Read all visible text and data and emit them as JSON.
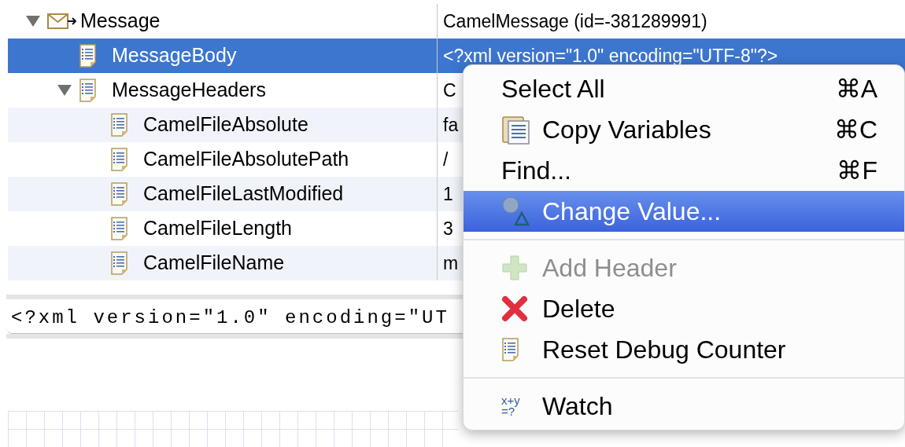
{
  "tree": [
    {
      "name": "Message",
      "kind": "message",
      "value": "CamelMessage (id=-381289991)",
      "expanded": true,
      "selected": false,
      "children": [
        {
          "name": "MessageBody",
          "kind": "variable",
          "value": "<?xml version=\"1.0\" encoding=\"UTF-8\"?>",
          "selected": true
        },
        {
          "name": "MessageHeaders",
          "kind": "variable",
          "value": "C",
          "expanded": true,
          "selected": false,
          "children": [
            {
              "name": "CamelFileAbsolute",
              "kind": "variable",
              "value": "fa",
              "selected": false
            },
            {
              "name": "CamelFileAbsolutePath",
              "kind": "variable",
              "value": "/",
              "selected": false
            },
            {
              "name": "CamelFileLastModified",
              "kind": "variable",
              "value": "1",
              "selected": false
            },
            {
              "name": "CamelFileLength",
              "kind": "variable",
              "value": "3",
              "selected": false
            },
            {
              "name": "CamelFileName",
              "kind": "variable",
              "value": "m",
              "selected": false
            }
          ]
        }
      ]
    }
  ],
  "detail": {
    "text": "<?xml version=\"1.0\" encoding=\"UT"
  },
  "context_menu": [
    {
      "kind": "plain",
      "label": "Select All",
      "shortcut": "⌘A",
      "disabled": false,
      "selected": false
    },
    {
      "kind": "copy",
      "label": "Copy Variables",
      "shortcut": "⌘C",
      "disabled": false,
      "selected": false
    },
    {
      "kind": "plain",
      "label": "Find...",
      "shortcut": "⌘F",
      "disabled": false,
      "selected": false
    },
    {
      "kind": "change",
      "label": "Change Value...",
      "disabled": false,
      "selected": true
    },
    {
      "kind": "separator"
    },
    {
      "kind": "add",
      "label": "Add Header",
      "disabled": true,
      "selected": false
    },
    {
      "kind": "delete",
      "label": "Delete",
      "disabled": false,
      "selected": false
    },
    {
      "kind": "reset",
      "label": "Reset Debug Counter",
      "disabled": false,
      "selected": false
    },
    {
      "kind": "separator"
    },
    {
      "kind": "watch",
      "label": "Watch",
      "icon_glyph": [
        "x+y",
        "=?"
      ],
      "disabled": false,
      "selected": false
    }
  ]
}
